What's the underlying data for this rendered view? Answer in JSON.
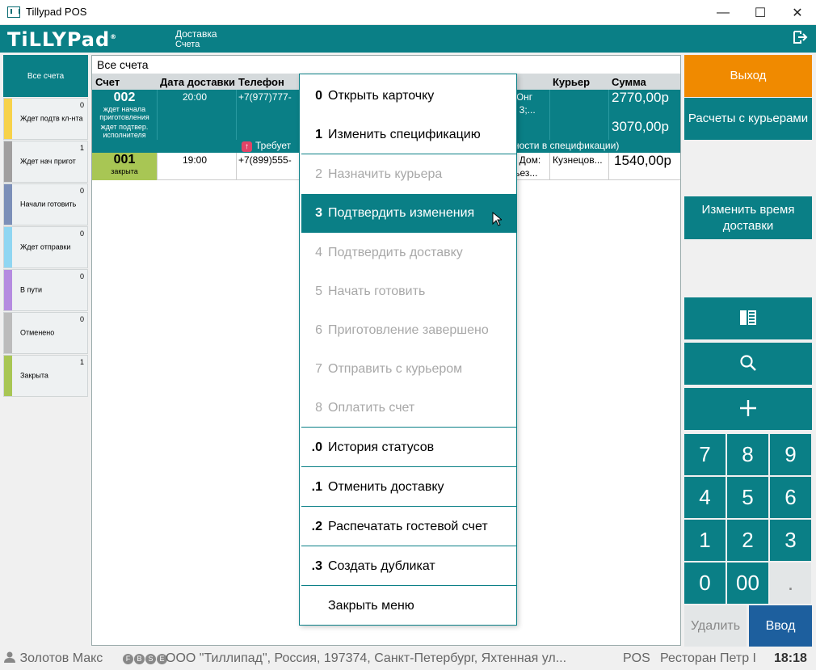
{
  "window": {
    "title": "Tillypad POS",
    "minimize": "—",
    "maximize": "☐",
    "close": "✕"
  },
  "header": {
    "logo": "TiLLYPad",
    "logo_mark": "®",
    "crumb_section": "Доставка",
    "crumb_page": "Счета",
    "logout_icon": "logout-icon"
  },
  "sidebar": {
    "all_label": "Все счета",
    "items": [
      {
        "label": "Ждет подтв кл-нта",
        "count": "0",
        "color": "#f7d24a"
      },
      {
        "label": "Ждет нач пригот",
        "count": "1",
        "color": "#a19f9f"
      },
      {
        "label": "Начали готовить",
        "count": "0",
        "color": "#7c8fb8"
      },
      {
        "label": "Ждет отправки",
        "count": "0",
        "color": "#8fd6f2"
      },
      {
        "label": "В пути",
        "count": "0",
        "color": "#b58be0"
      },
      {
        "label": "Отменено",
        "count": "0",
        "color": "#bcbcbc"
      },
      {
        "label": "Закрыта",
        "count": "1",
        "color": "#a8c654"
      }
    ]
  },
  "table": {
    "caption": "Все счета",
    "columns": {
      "bill": "Счет",
      "date": "Дата доставки",
      "phone": "Телефон",
      "courier": "Курьер",
      "sum": "Сумма"
    },
    "rows": [
      {
        "id": "002",
        "status_line1": "ждет начала приготовления",
        "status_line2": "ждет подтвер. исполнителя",
        "time": "20:00",
        "phone": "+7(977)777-",
        "address1": "Юнг",
        "address2": ": 3;...",
        "courier": "",
        "sum1": "2770,00р",
        "sum2": "3070,00р",
        "notice_left": "Требует",
        "notice_right": "ности в спецификации)"
      },
      {
        "id": "001",
        "status": "закрыта",
        "time": "19:00",
        "phone": "+7(899)555-",
        "address1": "; Дом:",
        "address2": "ъез...",
        "courier": "Кузнецов...",
        "sum": "1540,00р"
      }
    ]
  },
  "menu": {
    "items": [
      {
        "key": "0",
        "label": "Открыть карточку",
        "state": "normal"
      },
      {
        "key": "1",
        "label": "Изменить спецификацию",
        "state": "normal"
      },
      {
        "key": "2",
        "label": "Назначить курьера",
        "state": "disabled"
      },
      {
        "key": "3",
        "label": "Подтвердить изменения",
        "state": "selected"
      },
      {
        "key": "4",
        "label": "Подтвердить доставку",
        "state": "disabled"
      },
      {
        "key": "5",
        "label": "Начать готовить",
        "state": "disabled"
      },
      {
        "key": "6",
        "label": "Приготовление завершено",
        "state": "disabled"
      },
      {
        "key": "7",
        "label": "Отправить с курьером",
        "state": "disabled"
      },
      {
        "key": "8",
        "label": "Оплатить счет",
        "state": "disabled"
      },
      {
        "key": ".0",
        "label": "История статусов",
        "state": "normal"
      },
      {
        "key": ".1",
        "label": "Отменить доставку",
        "state": "normal"
      },
      {
        "key": ".2",
        "label": "Распечатать гостевой счет",
        "state": "normal"
      },
      {
        "key": ".3",
        "label": "Создать дубликат",
        "state": "normal"
      },
      {
        "key": "",
        "label": "Закрыть меню",
        "state": "normal"
      }
    ]
  },
  "right_panel": {
    "exit": "Выход",
    "courier_settlements": "Расчеты с курьерами",
    "change_delivery_time": "Изменить время доставки",
    "icons": [
      "column-view-icon",
      "search-icon",
      "plus-icon"
    ],
    "keypad": [
      "7",
      "8",
      "9",
      "4",
      "5",
      "6",
      "1",
      "2",
      "3",
      "0",
      "00",
      "."
    ],
    "delete": "Удалить",
    "enter": "Ввод"
  },
  "statusbar": {
    "user": "Золотов Макс",
    "badges": [
      "F",
      "B",
      "S",
      "E"
    ],
    "org": "ООО \"Тиллипад\", Россия, 197374, Санкт-Петербург, Яхтенная ул...",
    "terminal": "POS",
    "restaurant": "Ресторан Петр I",
    "time": "18:18"
  },
  "colors": {
    "accent": "#0a7f86",
    "exit": "#f08a00",
    "enter": "#1d5f9e",
    "closed": "#a8c654"
  }
}
